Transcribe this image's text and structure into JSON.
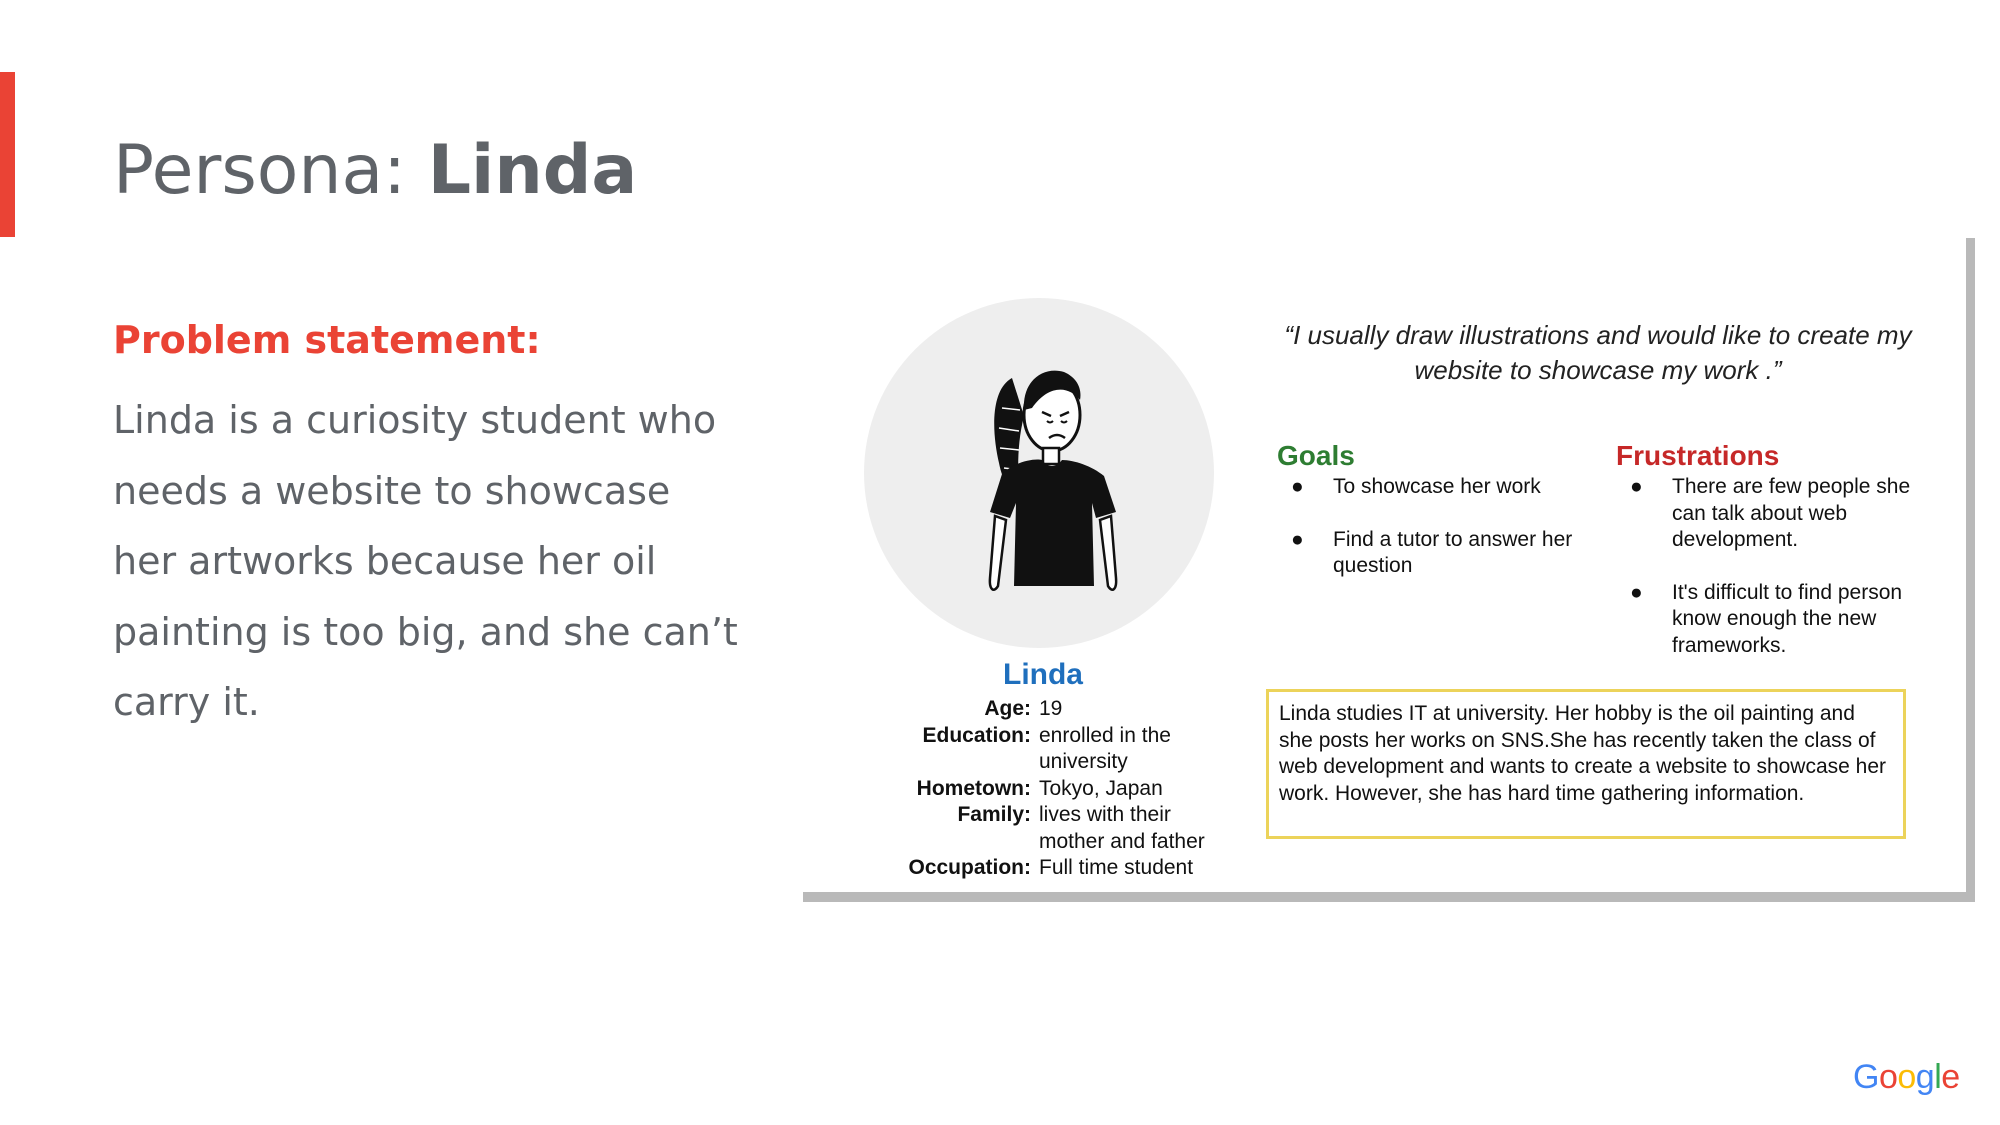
{
  "slide": {
    "title_prefix": "Persona: ",
    "title_name": "Linda",
    "problem_label": "Problem statement:",
    "problem_text": "Linda is a curiosity student who needs a website to showcase  her artworks because her oil painting is too big, and she can’t carry it."
  },
  "persona": {
    "name": "Linda",
    "quote": "“I usually draw illustrations and would like to create my website to showcase my work .”",
    "facts": [
      {
        "key": "Age:",
        "value": "19"
      },
      {
        "key": "Education:",
        "value": "enrolled in the university"
      },
      {
        "key": "Hometown:",
        "value": "Tokyo, Japan"
      },
      {
        "key": "Family:",
        "value": "lives with their mother and father"
      },
      {
        "key": "Occupation:",
        "value": "Full time student"
      }
    ],
    "goals_heading": "Goals",
    "goals": [
      "To showcase her work",
      "Find a tutor to answer her question"
    ],
    "frustrations_heading": "Frustrations",
    "frustrations": [
      "There are few people she can talk about web development.",
      "It's difficult to find person  know enough the new frameworks."
    ],
    "bio": "Linda studies IT at university. Her hobby is the oil painting and she posts her works on SNS.She has recently taken the class of web development and wants to create a website to showcase her work. However, she has hard time gathering information.",
    "bullet": "●"
  },
  "logo": {
    "letters": [
      "G",
      "o",
      "o",
      "g",
      "l",
      "e"
    ],
    "colors": [
      "#4285f4",
      "#ea4335",
      "#fbbc05",
      "#4285f4",
      "#34a853",
      "#ea4335"
    ]
  },
  "colors": {
    "accent": "#ea4335",
    "title_text": "#5f6368",
    "goals": "#2e7d32",
    "frustrations": "#c62828",
    "persona_name": "#1f6fbd",
    "bio_border": "#ecd35a"
  }
}
